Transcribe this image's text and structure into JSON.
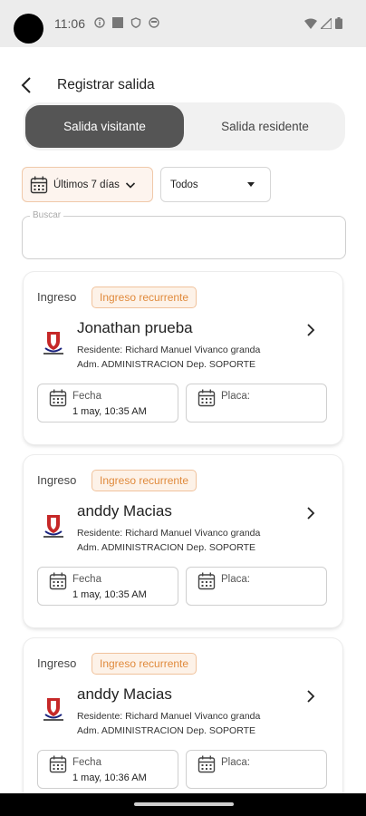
{
  "status_bar": {
    "time": "11:06"
  },
  "header": {
    "title": "Registrar salida"
  },
  "tabs": {
    "active": "Salida visitante",
    "inactive": "Salida residente"
  },
  "filters": {
    "date": "Últimos 7 días",
    "type": "Todos"
  },
  "search": {
    "label": "Buscar"
  },
  "cards": [
    {
      "type": "Ingreso",
      "badge": "Ingreso recurrente",
      "name": "Jonathan prueba",
      "resident": "Residente: Richard Manuel Vivanco granda",
      "adm": "Adm. ADMINISTRACION    Dep. SOPORTE",
      "fecha_label": "Fecha",
      "fecha_value": "1 may, 10:35 AM",
      "placa_label": "Placa:"
    },
    {
      "type": "Ingreso",
      "badge": "Ingreso recurrente",
      "name": "anddy Macias",
      "resident": "Residente: Richard Manuel Vivanco granda",
      "adm": "Adm. ADMINISTRACION    Dep. SOPORTE",
      "fecha_label": "Fecha",
      "fecha_value": "1 may, 10:35 AM",
      "placa_label": "Placa:"
    },
    {
      "type": "Ingreso",
      "badge": "Ingreso recurrente",
      "name": "anddy Macias",
      "resident": "Residente: Richard Manuel Vivanco granda",
      "adm": "Adm. ADMINISTRACION    Dep. SOPORTE",
      "fecha_label": "Fecha",
      "fecha_value": "1 may, 10:36 AM",
      "placa_label": "Placa:"
    }
  ],
  "colors": {
    "accent": "#e08a3c",
    "active_tab": "#555555",
    "badge_bg": "#fdf2e8"
  }
}
